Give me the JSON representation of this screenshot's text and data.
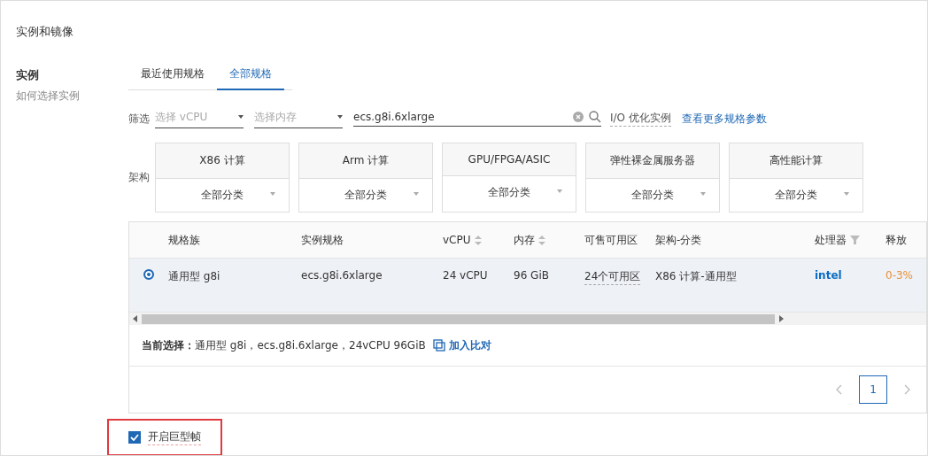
{
  "section_title": "实例和镜像",
  "side": {
    "title": "实例",
    "link": "如何选择实例"
  },
  "tabs": [
    {
      "label": "最近使用规格",
      "selected": false
    },
    {
      "label": "全部规格",
      "selected": true
    }
  ],
  "filter": {
    "label": "筛选",
    "vcpu_placeholder": "选择 vCPU",
    "memory_placeholder": "选择内存",
    "search_value": "ecs.g8i.6xlarge",
    "io_option": "I/O 优化实例",
    "more_link": "查看更多规格参数"
  },
  "arch": {
    "label": "架构",
    "groups": [
      {
        "name": "X86 计算",
        "category": "全部分类"
      },
      {
        "name": "Arm 计算",
        "category": "全部分类"
      },
      {
        "name": "GPU/FPGA/ASIC",
        "category": "全部分类"
      },
      {
        "name": "弹性裸金属服务器",
        "category": "全部分类"
      },
      {
        "name": "高性能计算",
        "category": "全部分类"
      }
    ]
  },
  "table": {
    "columns": [
      {
        "label": "规格族",
        "kind": "plain"
      },
      {
        "label": "实例规格",
        "kind": "plain"
      },
      {
        "label": "vCPU",
        "kind": "sort"
      },
      {
        "label": "内存",
        "kind": "sort"
      },
      {
        "label": "可售可用区",
        "kind": "plain"
      },
      {
        "label": "架构-分类",
        "kind": "plain"
      },
      {
        "label": "处理器",
        "kind": "filter"
      },
      {
        "label": "释放",
        "kind": "plain"
      }
    ],
    "rows": [
      {
        "selected": true,
        "cells": [
          "通用型 g8i",
          "ecs.g8i.6xlarge",
          "24 vCPU",
          "96 GiB",
          "24个可用区",
          "X86 计算-通用型",
          "intel",
          "0-3%"
        ]
      }
    ]
  },
  "current": {
    "label": "当前选择：",
    "value": "通用型 g8i，ecs.g8i.6xlarge，24vCPU 96GiB",
    "compare": "加入比对"
  },
  "pagination": {
    "pages": [
      {
        "label": "1",
        "selected": true
      }
    ]
  },
  "jumbo_frame": {
    "label": "开启巨型帧",
    "checked": true
  }
}
